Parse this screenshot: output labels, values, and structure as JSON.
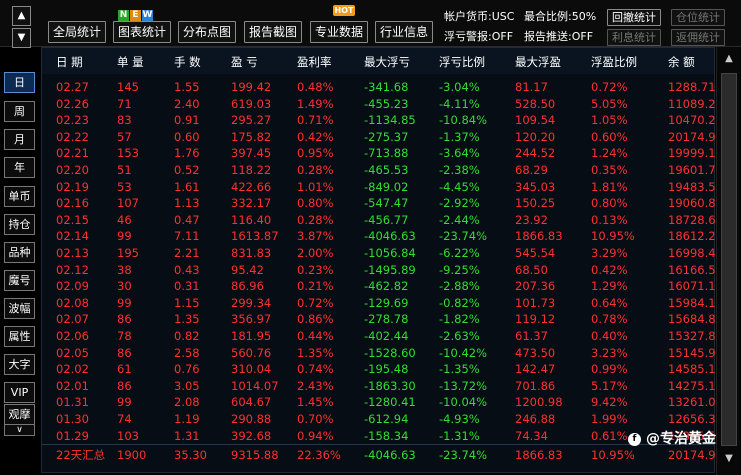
{
  "toolbar": {
    "buttons": [
      "全局统计",
      "图表统计",
      "分布点图",
      "报告截图",
      "专业数据",
      "行业信息"
    ],
    "new_badge": [
      "N",
      "E",
      "W"
    ],
    "hot_badge": "HOT",
    "account_currency": "帐户货币:USC",
    "close_ratio": "最合比例:50%",
    "float_loss_alert": "浮亏警报:OFF",
    "report_push": "报告推送:OFF",
    "withdraw_stats": "回撤统计",
    "position_stats": "仓位统计",
    "interest_stats": "利息统计",
    "commission_stats": "返佣统计"
  },
  "side": {
    "up_arrow": "▲",
    "down_arrow": "▼",
    "buttons": [
      "日",
      "周",
      "月",
      "年",
      "单币",
      "持仓",
      "品种",
      "魔号",
      "波幅",
      "属性",
      "大字",
      "VIP",
      "观摩"
    ],
    "more": "∨"
  },
  "table": {
    "headers": [
      "日 期",
      "单 量",
      "手 数",
      "盈 亏",
      "盈利率",
      "最大浮亏",
      "浮亏比例",
      "最大浮盈",
      "浮盈比例",
      "余 额"
    ],
    "rows": [
      [
        "02.27",
        "145",
        "1.55",
        "199.42",
        "0.48%",
        "-341.68",
        "-3.04%",
        "81.17",
        "0.72%",
        "1288.71"
      ],
      [
        "02.26",
        "71",
        "2.40",
        "619.03",
        "1.49%",
        "-455.23",
        "-4.11%",
        "528.50",
        "5.05%",
        "11089.29"
      ],
      [
        "02.23",
        "83",
        "0.91",
        "295.27",
        "0.71%",
        "-1134.85",
        "-10.84%",
        "109.54",
        "1.05%",
        "10470.26"
      ],
      [
        "02.22",
        "57",
        "0.60",
        "175.82",
        "0.42%",
        "-275.37",
        "-1.37%",
        "120.20",
        "0.60%",
        "20174.99"
      ],
      [
        "02.21",
        "153",
        "1.76",
        "397.45",
        "0.95%",
        "-713.88",
        "-3.64%",
        "244.52",
        "1.24%",
        "19999.17"
      ],
      [
        "02.20",
        "51",
        "0.52",
        "118.22",
        "0.28%",
        "-465.53",
        "-2.38%",
        "68.29",
        "0.35%",
        "19601.72"
      ],
      [
        "02.19",
        "53",
        "1.61",
        "422.66",
        "1.01%",
        "-849.02",
        "-4.45%",
        "345.03",
        "1.81%",
        "19483.50"
      ],
      [
        "02.16",
        "107",
        "1.13",
        "332.17",
        "0.80%",
        "-547.47",
        "-2.92%",
        "150.25",
        "0.80%",
        "19060.84"
      ],
      [
        "02.15",
        "46",
        "0.47",
        "116.40",
        "0.28%",
        "-456.77",
        "-2.44%",
        "23.92",
        "0.13%",
        "18728.67"
      ],
      [
        "02.14",
        "99",
        "7.11",
        "1613.87",
        "3.87%",
        "-4046.63",
        "-23.74%",
        "1866.83",
        "10.95%",
        "18612.27"
      ],
      [
        "02.13",
        "195",
        "2.21",
        "831.83",
        "2.00%",
        "-1056.84",
        "-6.22%",
        "545.54",
        "3.29%",
        "16998.40"
      ],
      [
        "02.12",
        "38",
        "0.43",
        "95.42",
        "0.23%",
        "-1495.89",
        "-9.25%",
        "68.50",
        "0.42%",
        "16166.57"
      ],
      [
        "02.09",
        "30",
        "0.31",
        "86.96",
        "0.21%",
        "-462.82",
        "-2.88%",
        "207.36",
        "1.29%",
        "16071.15"
      ],
      [
        "02.08",
        "99",
        "1.15",
        "299.34",
        "0.72%",
        "-129.69",
        "-0.82%",
        "101.73",
        "0.64%",
        "15984.19"
      ],
      [
        "02.07",
        "86",
        "1.35",
        "356.97",
        "0.86%",
        "-278.78",
        "-1.82%",
        "119.12",
        "0.78%",
        "15684.85"
      ],
      [
        "02.06",
        "78",
        "0.82",
        "181.95",
        "0.44%",
        "-402.44",
        "-2.63%",
        "61.37",
        "0.40%",
        "15327.88"
      ],
      [
        "02.05",
        "86",
        "2.58",
        "560.76",
        "1.35%",
        "-1528.60",
        "-10.42%",
        "473.50",
        "3.23%",
        "15145.93"
      ],
      [
        "02.02",
        "61",
        "0.76",
        "310.04",
        "0.74%",
        "-195.48",
        "-1.35%",
        "142.47",
        "0.99%",
        "14585.17"
      ],
      [
        "02.01",
        "86",
        "3.05",
        "1014.07",
        "2.43%",
        "-1863.30",
        "-13.72%",
        "701.86",
        "5.17%",
        "14275.13"
      ],
      [
        "01.31",
        "99",
        "2.08",
        "604.67",
        "1.45%",
        "-1280.41",
        "-10.04%",
        "1200.98",
        "9.42%",
        "13261.06"
      ],
      [
        "01.30",
        "74",
        "1.19",
        "290.88",
        "0.70%",
        "-612.94",
        "-4.93%",
        "246.88",
        "1.99%",
        "12656.39"
      ],
      [
        "01.29",
        "103",
        "1.31",
        "392.68",
        "0.94%",
        "-158.34",
        "-1.31%",
        "74.34",
        "0.61%",
        "12365.51"
      ]
    ],
    "summary": [
      "22天汇总",
      "1900",
      "35.30",
      "9315.88",
      "22.36%",
      "-4046.63",
      "-23.74%",
      "1866.83",
      "10.95%",
      "20174.99"
    ]
  },
  "scroll": {
    "up": "▲",
    "down": "▼"
  },
  "watermark": {
    "icon": "f",
    "text": "@专治黄金"
  },
  "colors": {
    "positive": "#ff3030",
    "negative": "#33dd33",
    "active_button": "#0d2b52"
  }
}
